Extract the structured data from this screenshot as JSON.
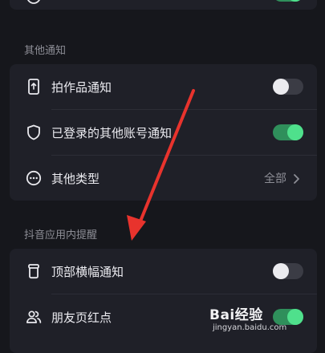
{
  "colors": {
    "background": "#16171c",
    "card": "#1f2028",
    "toggle_on": "#4fe08c",
    "toggle_off": "#3b3c45",
    "annotation_arrow": "#e8332d"
  },
  "sections": [
    {
      "title": "其他通知",
      "items": [
        {
          "label": "拍作品通知",
          "icon": "phone-icon",
          "control": "toggle",
          "checked": false
        },
        {
          "label": "已登录的其他账号通知",
          "icon": "shield-icon",
          "control": "toggle",
          "checked": true
        },
        {
          "label": "其他类型",
          "icon": "more-icon",
          "control": "link",
          "value": "全部"
        }
      ]
    },
    {
      "title": "抖音应用内提醒",
      "items": [
        {
          "label": "顶部横幅通知",
          "icon": "cup-icon",
          "control": "toggle",
          "checked": false
        },
        {
          "label": "朋友页红点",
          "icon": "users-icon",
          "control": "toggle",
          "checked": true
        }
      ]
    }
  ],
  "watermark": {
    "logo_text": "Bai经验",
    "url": "jingyan.baidu.com"
  }
}
